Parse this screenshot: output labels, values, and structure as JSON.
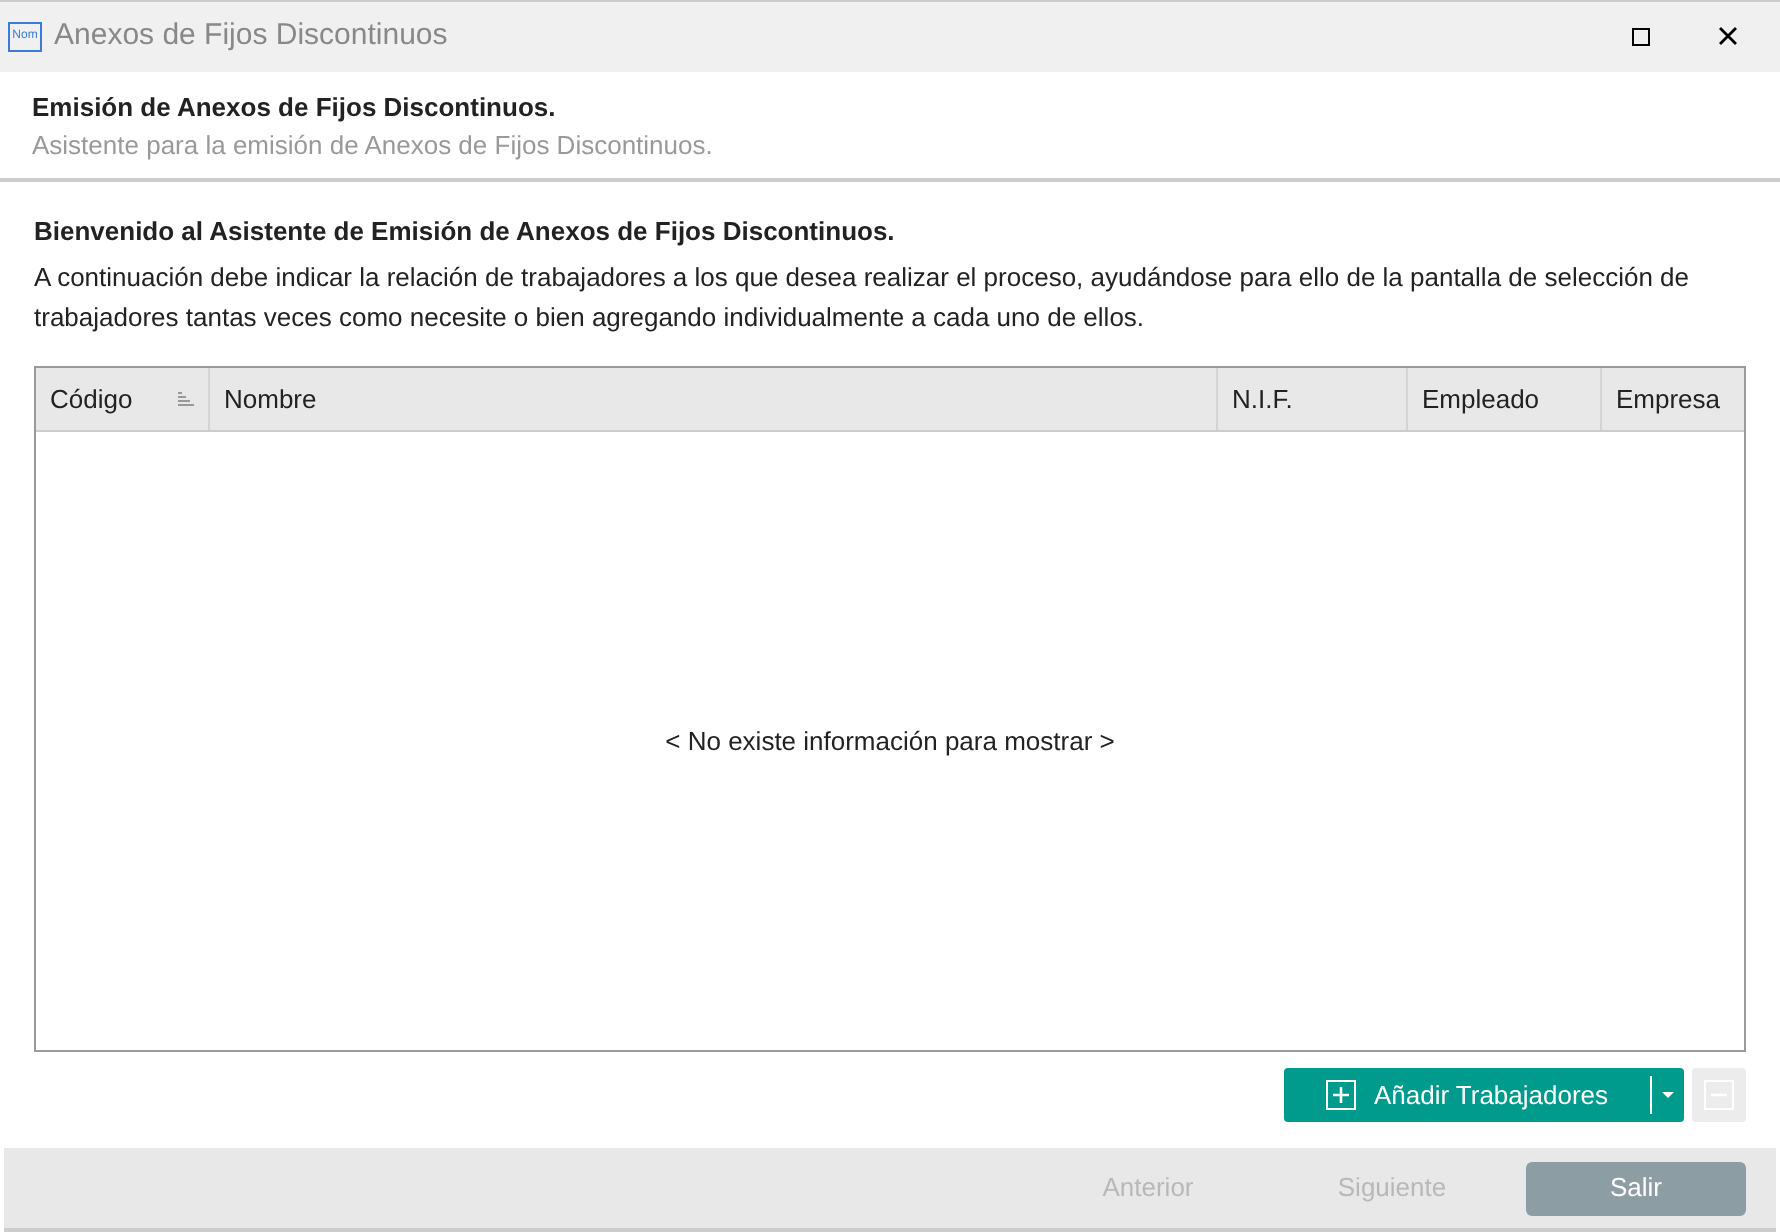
{
  "window": {
    "icon_label": "Nom",
    "title": "Anexos de Fijos Discontinuos"
  },
  "header": {
    "title": "Emisión de Anexos de Fijos Discontinuos.",
    "subtitle": "Asistente para la emisión de Anexos de Fijos Discontinuos."
  },
  "intro": {
    "heading": "Bienvenido al Asistente de Emisión de Anexos de Fijos Discontinuos.",
    "text": "A continuación debe indicar la relación de trabajadores a los que desea realizar el proceso, ayudándose para ello de la pantalla de selección de trabajadores tantas veces como necesite o bien agregando individualmente a cada uno de ellos."
  },
  "table": {
    "columns": [
      {
        "label": "Código",
        "sorted": true
      },
      {
        "label": "Nombre",
        "sorted": false
      },
      {
        "label": "N.I.F.",
        "sorted": false
      },
      {
        "label": "Empleado",
        "sorted": false
      },
      {
        "label": "Empresa",
        "sorted": false
      }
    ],
    "empty_message": "< No existe información para mostrar >"
  },
  "add_button": {
    "label": "Añadir Trabajadores"
  },
  "remove_button": {
    "disabled": true
  },
  "footer_buttons": [
    {
      "label": "Anterior",
      "disabled": true,
      "kind": "link"
    },
    {
      "label": "Siguiente",
      "disabled": true,
      "kind": "link"
    },
    {
      "label": "Salir",
      "disabled": false,
      "kind": "primary"
    }
  ]
}
